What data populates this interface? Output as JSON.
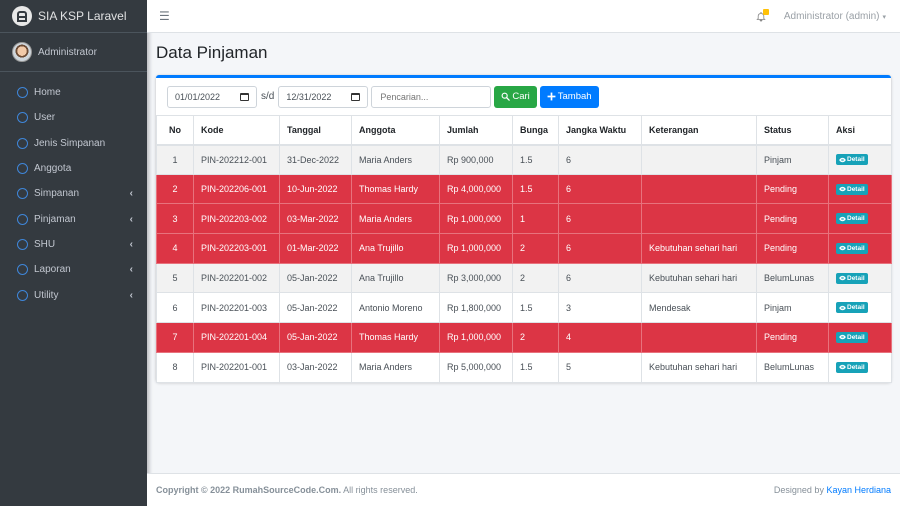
{
  "app": {
    "title": "SIA KSP Laravel"
  },
  "user_panel": {
    "name": "Administrator"
  },
  "sidebar": {
    "items": [
      {
        "label": "Home",
        "has_children": false
      },
      {
        "label": "User",
        "has_children": false
      },
      {
        "label": "Jenis Simpanan",
        "has_children": false
      },
      {
        "label": "Anggota",
        "has_children": false
      },
      {
        "label": "Simpanan",
        "has_children": true
      },
      {
        "label": "Pinjaman",
        "has_children": true
      },
      {
        "label": "SHU",
        "has_children": true
      },
      {
        "label": "Laporan",
        "has_children": true
      },
      {
        "label": "Utility",
        "has_children": true
      }
    ],
    "chevron": "‹"
  },
  "topbar": {
    "menu_icon": "☰",
    "user_menu": "Administrator (admin)",
    "caret": "▾"
  },
  "page": {
    "title": "Data Pinjaman"
  },
  "filters": {
    "date_from": "01/01/2022",
    "separator": "s/d",
    "date_to": "12/31/2022",
    "search_placeholder": "Pencarian...",
    "search_value": "",
    "cari_label": "Cari",
    "tambah_label": "Tambah"
  },
  "table": {
    "headers": [
      "No",
      "Kode",
      "Tanggal",
      "Anggota",
      "Jumlah",
      "Bunga",
      "Jangka Waktu",
      "Keterangan",
      "Status",
      "Aksi"
    ],
    "action_label": "Detail",
    "rows": [
      {
        "no": "1",
        "kode": "PIN-202212-001",
        "tanggal": "31-Dec-2022",
        "anggota": "Maria Anders",
        "jumlah": "Rp 900,000",
        "bunga": "1.5",
        "jangka": "6",
        "keterangan": "",
        "status": "Pinjam"
      },
      {
        "no": "2",
        "kode": "PIN-202206-001",
        "tanggal": "10-Jun-2022",
        "anggota": "Thomas Hardy",
        "jumlah": "Rp 4,000,000",
        "bunga": "1.5",
        "jangka": "6",
        "keterangan": "",
        "status": "Pending"
      },
      {
        "no": "3",
        "kode": "PIN-202203-002",
        "tanggal": "03-Mar-2022",
        "anggota": "Maria Anders",
        "jumlah": "Rp 1,000,000",
        "bunga": "1",
        "jangka": "6",
        "keterangan": "",
        "status": "Pending"
      },
      {
        "no": "4",
        "kode": "PIN-202203-001",
        "tanggal": "01-Mar-2022",
        "anggota": "Ana Trujillo",
        "jumlah": "Rp 1,000,000",
        "bunga": "2",
        "jangka": "6",
        "keterangan": "Kebutuhan sehari hari",
        "status": "Pending"
      },
      {
        "no": "5",
        "kode": "PIN-202201-002",
        "tanggal": "05-Jan-2022",
        "anggota": "Ana Trujillo",
        "jumlah": "Rp 3,000,000",
        "bunga": "2",
        "jangka": "6",
        "keterangan": "Kebutuhan sehari hari",
        "status": "BelumLunas"
      },
      {
        "no": "6",
        "kode": "PIN-202201-003",
        "tanggal": "05-Jan-2022",
        "anggota": "Antonio Moreno",
        "jumlah": "Rp 1,800,000",
        "bunga": "1.5",
        "jangka": "3",
        "keterangan": "Mendesak",
        "status": "Pinjam"
      },
      {
        "no": "7",
        "kode": "PIN-202201-004",
        "tanggal": "05-Jan-2022",
        "anggota": "Thomas Hardy",
        "jumlah": "Rp 1,000,000",
        "bunga": "2",
        "jangka": "4",
        "keterangan": "",
        "status": "Pending"
      },
      {
        "no": "8",
        "kode": "PIN-202201-001",
        "tanggal": "03-Jan-2022",
        "anggota": "Maria Anders",
        "jumlah": "Rp 5,000,000",
        "bunga": "1.5",
        "jangka": "5",
        "keterangan": "Kebutuhan sehari hari",
        "status": "BelumLunas"
      }
    ]
  },
  "footer": {
    "copyright_bold": "Copyright © 2022 RumahSourceCode.Com.",
    "copyright_rest": " All rights reserved.",
    "designed_by": "Designed by ",
    "designer": "Kayan Herdiana"
  },
  "colors": {
    "primary": "#007bff",
    "success": "#28a745",
    "danger": "#dc3545",
    "info": "#17a2b8",
    "sidebar_bg": "#343a40",
    "warning": "#ffc107"
  }
}
